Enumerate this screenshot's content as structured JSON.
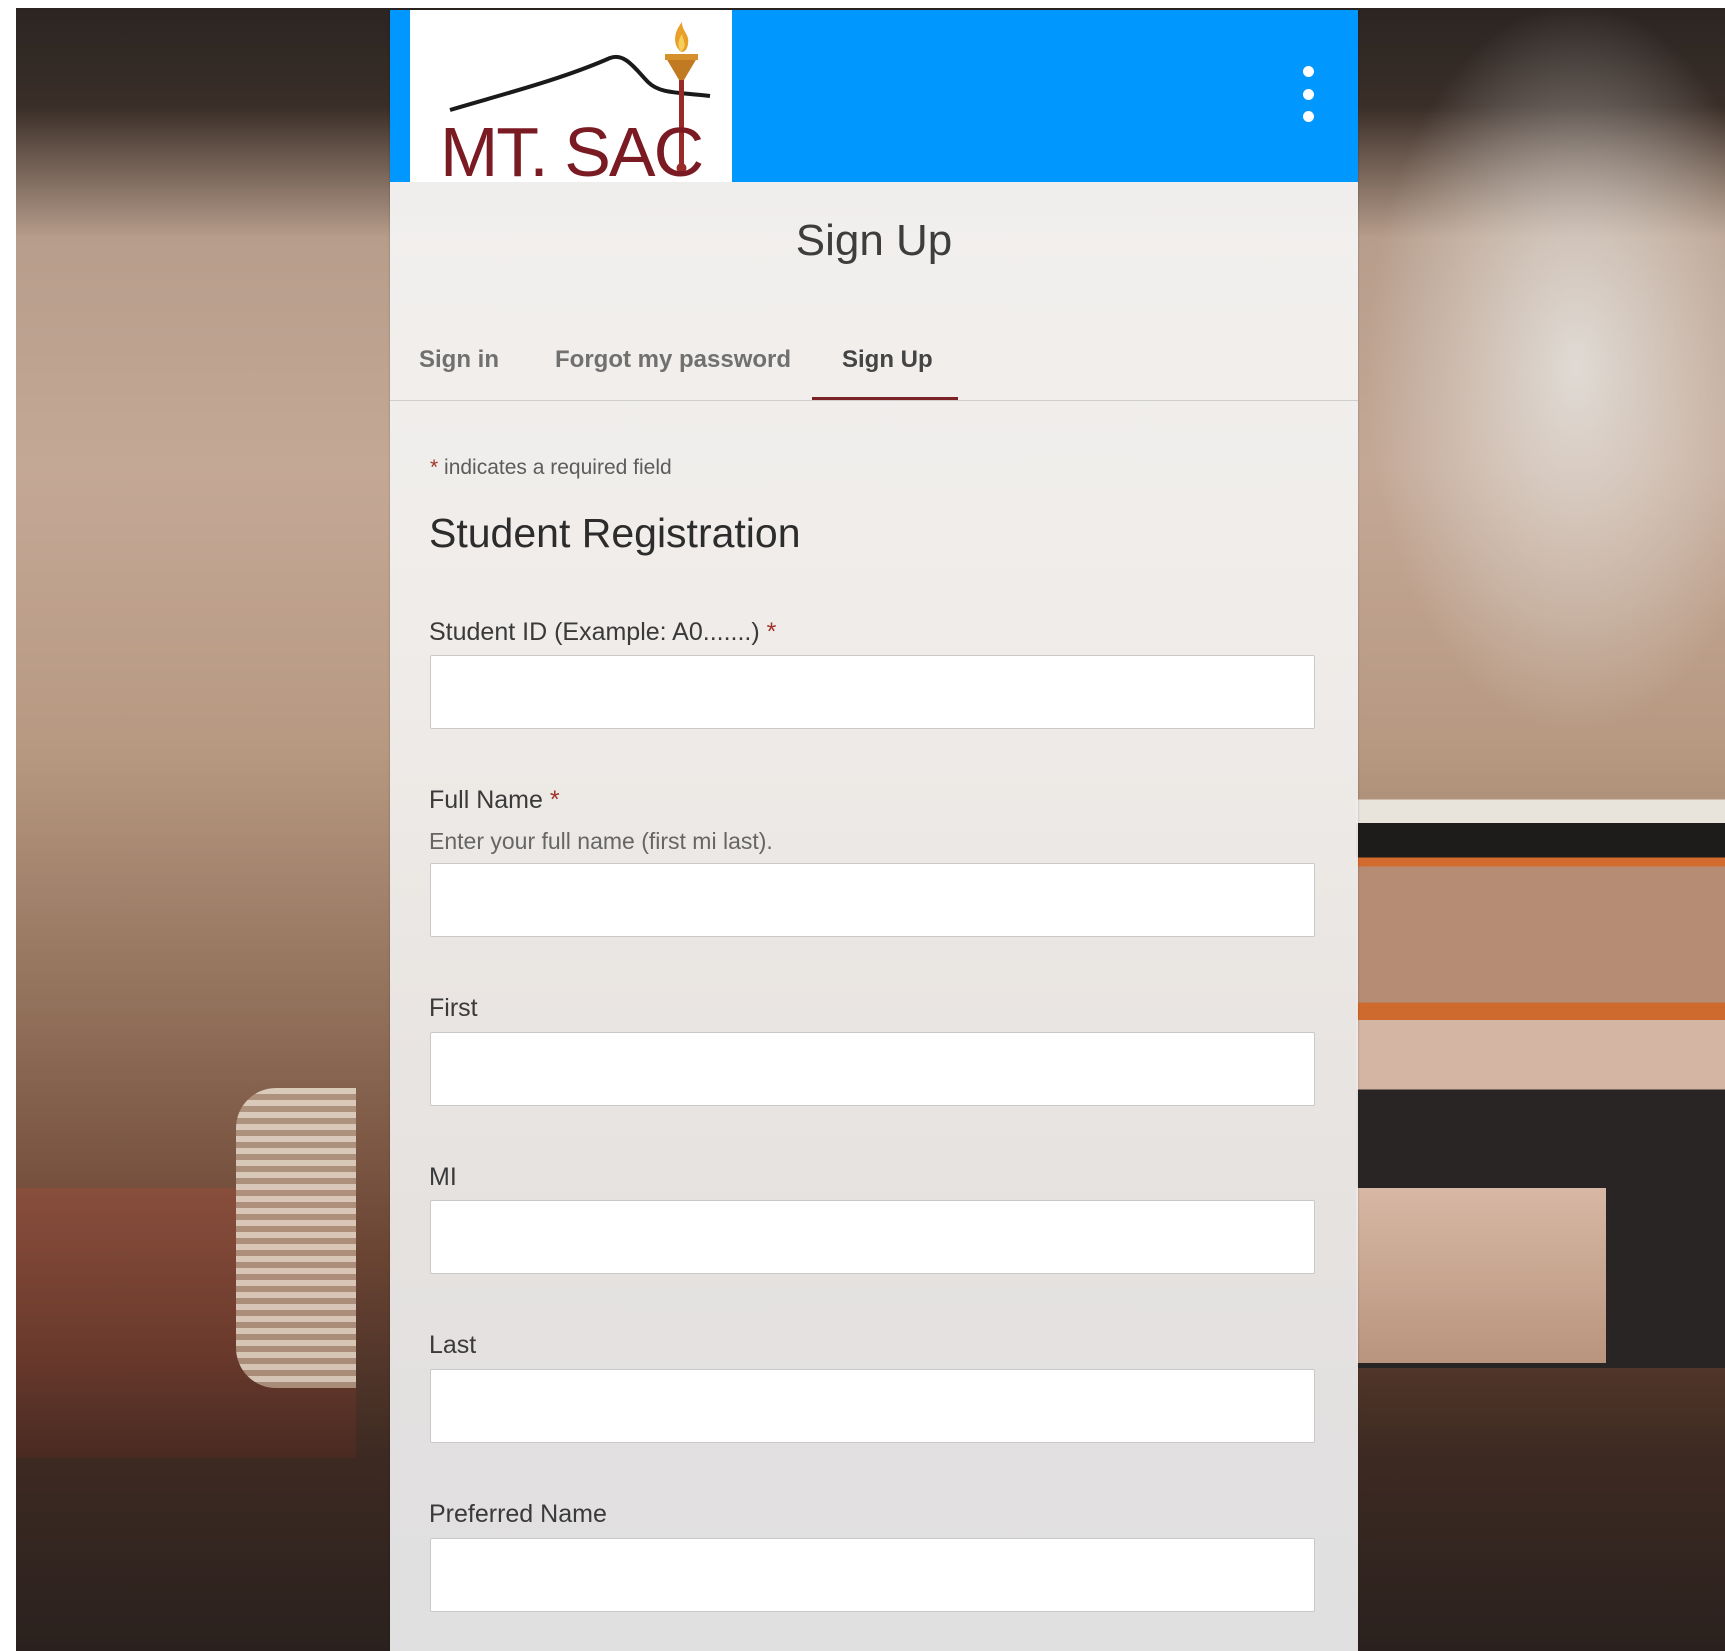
{
  "brand": {
    "logo_text": "MT. SAC",
    "header_color": "#0098fe",
    "accent_color": "#7b2227"
  },
  "header": {
    "menu_icon": "more-vertical-icon"
  },
  "page": {
    "title": "Sign Up"
  },
  "tabs": [
    {
      "label": "Sign in",
      "active": false
    },
    {
      "label": "Forgot my password",
      "active": false
    },
    {
      "label": "Sign Up",
      "active": true
    }
  ],
  "form": {
    "required_note_asterisk": "*",
    "required_note_text": " indicates a required field",
    "section_title": "Student Registration",
    "fields": [
      {
        "label": "Student ID (Example: A0.......)",
        "required": true,
        "description": "",
        "value": ""
      },
      {
        "label": "Full Name",
        "required": true,
        "description": "Enter your full name (first mi last).",
        "value": ""
      },
      {
        "label": "First",
        "required": false,
        "description": "",
        "value": ""
      },
      {
        "label": "MI",
        "required": false,
        "description": "",
        "value": ""
      },
      {
        "label": "Last",
        "required": false,
        "description": "",
        "value": ""
      },
      {
        "label": "Preferred Name",
        "required": false,
        "description": "",
        "value": ""
      }
    ],
    "required_marker": "*"
  }
}
